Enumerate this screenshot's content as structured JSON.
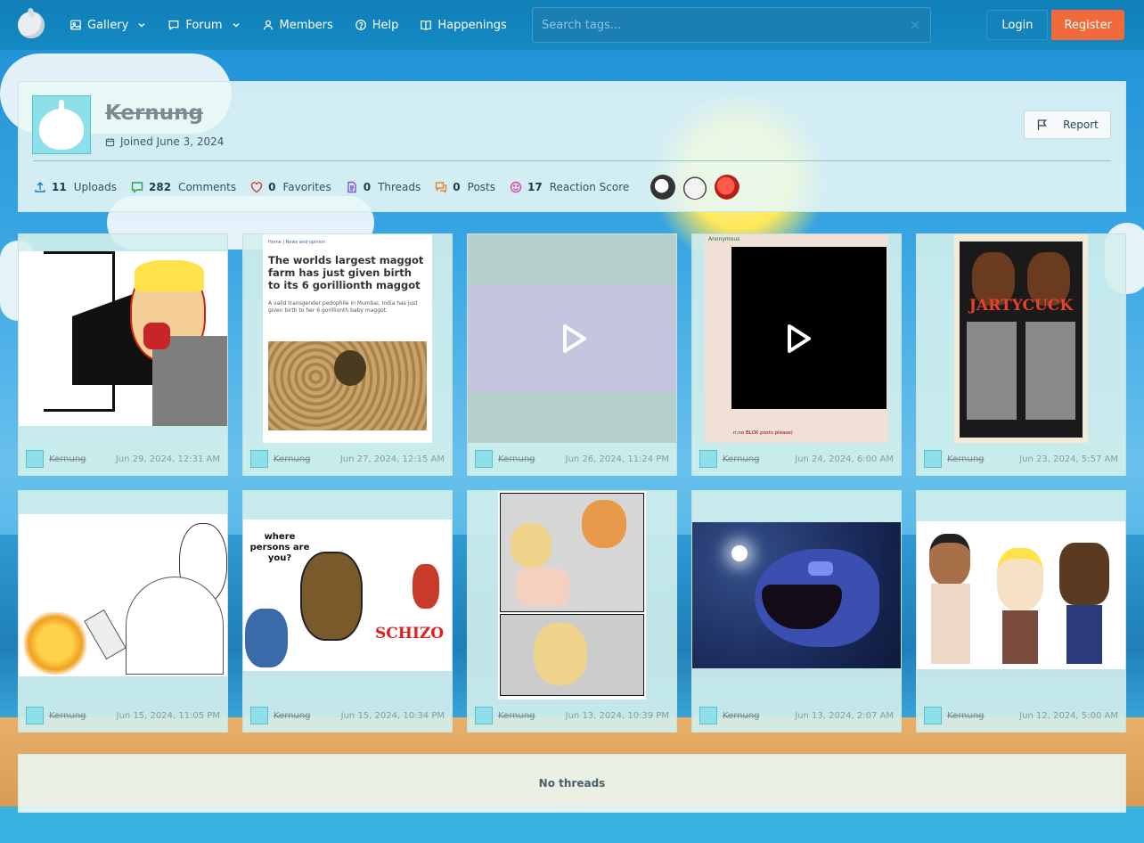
{
  "nav": {
    "items": [
      {
        "label": "Gallery",
        "icon": "image-icon",
        "dropdown": true
      },
      {
        "label": "Forum",
        "icon": "chat-icon",
        "dropdown": true
      },
      {
        "label": "Members",
        "icon": "user-icon",
        "dropdown": false
      },
      {
        "label": "Help",
        "icon": "help-icon",
        "dropdown": false
      },
      {
        "label": "Happenings",
        "icon": "book-icon",
        "dropdown": false
      }
    ],
    "search_placeholder": "Search tags...",
    "login_label": "Login",
    "register_label": "Register"
  },
  "profile": {
    "username": "Kernung",
    "joined": "Joined June 3, 2024",
    "report_label": "Report",
    "stats": [
      {
        "value": "11",
        "label": "Uploads",
        "icon": "upload-icon",
        "color": "#1a7fc1"
      },
      {
        "value": "282",
        "label": "Comments",
        "icon": "comment-icon",
        "color": "#2aa44b"
      },
      {
        "value": "0",
        "label": "Favorites",
        "icon": "heart-icon",
        "color": "#d93b3b"
      },
      {
        "value": "0",
        "label": "Threads",
        "icon": "document-icon",
        "color": "#8a4fd1"
      },
      {
        "value": "0",
        "label": "Posts",
        "icon": "posts-icon",
        "color": "#e5872a"
      },
      {
        "value": "17",
        "label": "Reaction Score",
        "icon": "reaction-icon",
        "color": "#d946a8"
      }
    ],
    "trophies": [
      "skull-trophy",
      "onion-trophy",
      "red-helmet-trophy"
    ]
  },
  "gallery": [
    {
      "user": "Kernung",
      "date": "Jun 29, 2024, 12:31 AM",
      "type": "image",
      "theme": "soyjak-red"
    },
    {
      "user": "Kernung",
      "date": "Jun 27, 2024, 12:15 AM",
      "type": "image",
      "theme": "article-maggot",
      "article_crumbs": "Home | News and opinion",
      "article_title": "The worlds largest maggot farm has just given birth to its 6 gorillionth maggot",
      "article_body": "A valid transgender pedophile in Mumbai, India has just given birth to her 6 gorillionth baby maggot."
    },
    {
      "user": "Kernung",
      "date": "Jun 26, 2024, 11:24 PM",
      "type": "video",
      "theme": "video-purple"
    },
    {
      "user": "Kernung",
      "date": "Jun 24, 2024, 6:00 AM",
      "type": "video",
      "theme": "video-black",
      "header": "Anonymous",
      "caption": "n;no BLOX posts please)"
    },
    {
      "user": "Kernung",
      "date": "Jun 23, 2024, 5:57 AM",
      "type": "image",
      "theme": "poster",
      "poster_title": "JARTYCUCK"
    },
    {
      "user": "Kernung",
      "date": "Jun 15, 2024, 11:05 PM",
      "type": "image",
      "theme": "soyjak-fire"
    },
    {
      "user": "Kernung",
      "date": "Jun 15, 2024, 10:34 PM",
      "type": "image",
      "theme": "schizo",
      "heading": "where persons are you?",
      "tag": "SCHIZO"
    },
    {
      "user": "Kernung",
      "date": "Jun 13, 2024, 10:39 PM",
      "type": "image",
      "theme": "comic"
    },
    {
      "user": "Kernung",
      "date": "Jun 13, 2024, 2:07 AM",
      "type": "image",
      "theme": "anglerfish"
    },
    {
      "user": "Kernung",
      "date": "Jun 12, 2024, 5:00 AM",
      "type": "image",
      "theme": "trio"
    }
  ],
  "threads": {
    "empty_label": "No threads"
  }
}
